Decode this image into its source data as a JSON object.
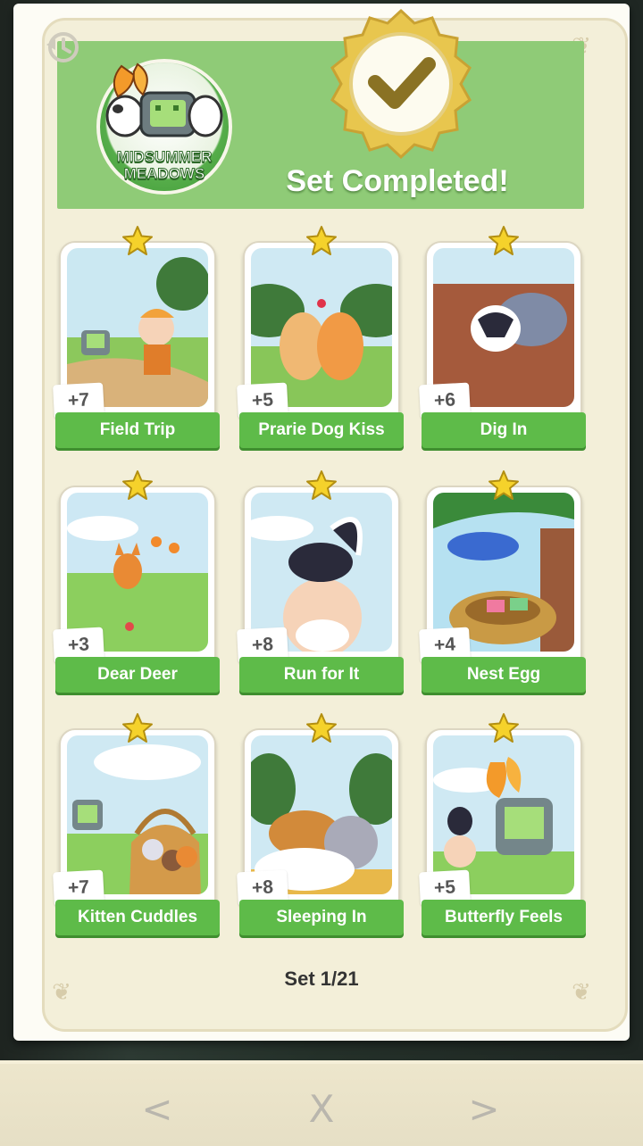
{
  "album": {
    "set_name": "MIDSUMMER MEADOWS",
    "status": "Set Completed!",
    "set_index": "Set 1/21"
  },
  "cards": [
    {
      "name": "Field Trip",
      "count": "+7",
      "art": "field-trip"
    },
    {
      "name": "Prarie Dog Kiss",
      "count": "+5",
      "art": "prairie-dog"
    },
    {
      "name": "Dig In",
      "count": "+6",
      "art": "badger"
    },
    {
      "name": "Dear Deer",
      "count": "+3",
      "art": "fox"
    },
    {
      "name": "Run for It",
      "count": "+8",
      "art": "skunk"
    },
    {
      "name": "Nest Egg",
      "count": "+4",
      "art": "bird-nest"
    },
    {
      "name": "Kitten Cuddles",
      "count": "+7",
      "art": "kittens"
    },
    {
      "name": "Sleeping In",
      "count": "+8",
      "art": "rabbits"
    },
    {
      "name": "Butterfly Feels",
      "count": "+5",
      "art": "butterfly"
    }
  ],
  "nav": {
    "prev": "<",
    "close": "X",
    "next": ">"
  },
  "colors": {
    "header_green": "#8fcb77",
    "label_green": "#5ebb49",
    "seal_gold": "#e8c64e",
    "star_yellow": "#f5d22b"
  },
  "icons": [
    "history-icon",
    "check-seal-icon",
    "star-icon",
    "chevron-left-icon",
    "close-icon",
    "chevron-right-icon"
  ]
}
